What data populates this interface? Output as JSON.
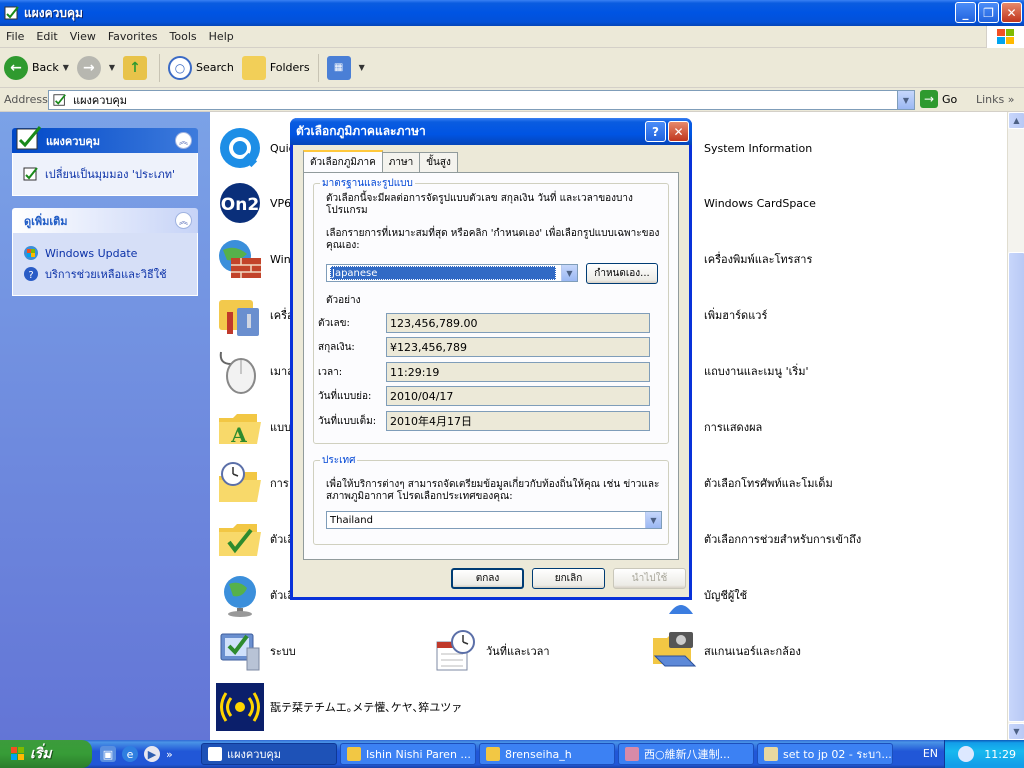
{
  "window": {
    "title": "แผงควบคุม",
    "menu": [
      "File",
      "Edit",
      "View",
      "Favorites",
      "Tools",
      "Help"
    ],
    "toolbar": {
      "back": "Back",
      "search": "Search",
      "folders": "Folders"
    },
    "address": {
      "label": "Address",
      "value": "แผงควบคุม",
      "go": "Go",
      "links": "Links"
    }
  },
  "taskpane": {
    "panel1": {
      "title": "แผงควบคุม",
      "link": "เปลี่ยนเป็นมุมมอง 'ประเภท'"
    },
    "panel2": {
      "title": "ดูเพิ่มเติม",
      "links": [
        "Windows Update",
        "บริการช่วยเหลือและวิธีใช้"
      ]
    }
  },
  "icons": {
    "left": [
      "Quic",
      "VP6",
      "Wind",
      "เครื่อ",
      "เมาส์",
      "แบบ",
      "การ",
      "ตัวเลื",
      "ตัวเลื",
      "ระบบ",
      "翫テ栞テチムエ｡メテ懽､ケヤ､猝ユツァ"
    ],
    "middle": [
      "วันที่และเวลา"
    ],
    "right": [
      "System Information",
      "Windows CardSpace",
      "เครื่องพิมพ์และโทรสาร",
      "เพิ่มฮาร์ดแวร์",
      "แถบงานและเมนู 'เริ่ม'",
      "การแสดงผล",
      "ตัวเลือกโทรศัพท์และโมเด็ม",
      "ตัวเลือกการช่วยสำหรับการเข้าถึง",
      "บัญชีผู้ใช้",
      "สแกนเนอร์และกล้อง"
    ]
  },
  "dialog": {
    "title": "ตัวเลือกภูมิภาคและภาษา",
    "tabs": [
      "ตัวเลือกภูมิภาค",
      "ภาษา",
      "ขั้นสูง"
    ],
    "standards": {
      "legend": "มาตรฐานและรูปแบบ",
      "desc": "ตัวเลือกนี้จะมีผลต่อการจัดรูปแบบตัวเลข สกุลเงิน วันที่ และเวลาของบางโปรแกรม",
      "select_prompt": "เลือกรายการที่เหมาะสมที่สุด หรือคลิก 'กำหนดเอง' เพื่อเลือกรูปแบบเฉพาะของคุณเอง:",
      "selected": "Japanese",
      "customize": "กำหนดเอง...",
      "samples_label": "ตัวอย่าง",
      "samples": [
        {
          "label": "ตัวเลข:",
          "value": "123,456,789.00"
        },
        {
          "label": "สกุลเงิน:",
          "value": "¥123,456,789"
        },
        {
          "label": "เวลา:",
          "value": "11:29:19"
        },
        {
          "label": "วันที่แบบย่อ:",
          "value": "2010/04/17"
        },
        {
          "label": "วันที่แบบเต็ม:",
          "value": "2010年4月17日"
        }
      ]
    },
    "location": {
      "legend": "ประเทศ",
      "desc": "เพื่อให้บริการต่างๆ สามารถจัดเตรียมข้อมูลเกี่ยวกับท้องถิ่นให้คุณ เช่น ข่าวและสภาพภูมิอากาศ โปรดเลือกประเทศของคุณ:",
      "selected": "Thailand"
    },
    "buttons": {
      "ok": "ตกลง",
      "cancel": "ยกเลิก",
      "apply": "นำไปใช้"
    }
  },
  "taskbar": {
    "start": "เริ่ม",
    "tasks": [
      "แผงควบคุม",
      "Ishin Nishi Paren ...",
      "8renseiha_h",
      "西○維新八連制...",
      "set to jp 02 - ระบา..."
    ],
    "lang": "EN",
    "clock": "11:29"
  }
}
